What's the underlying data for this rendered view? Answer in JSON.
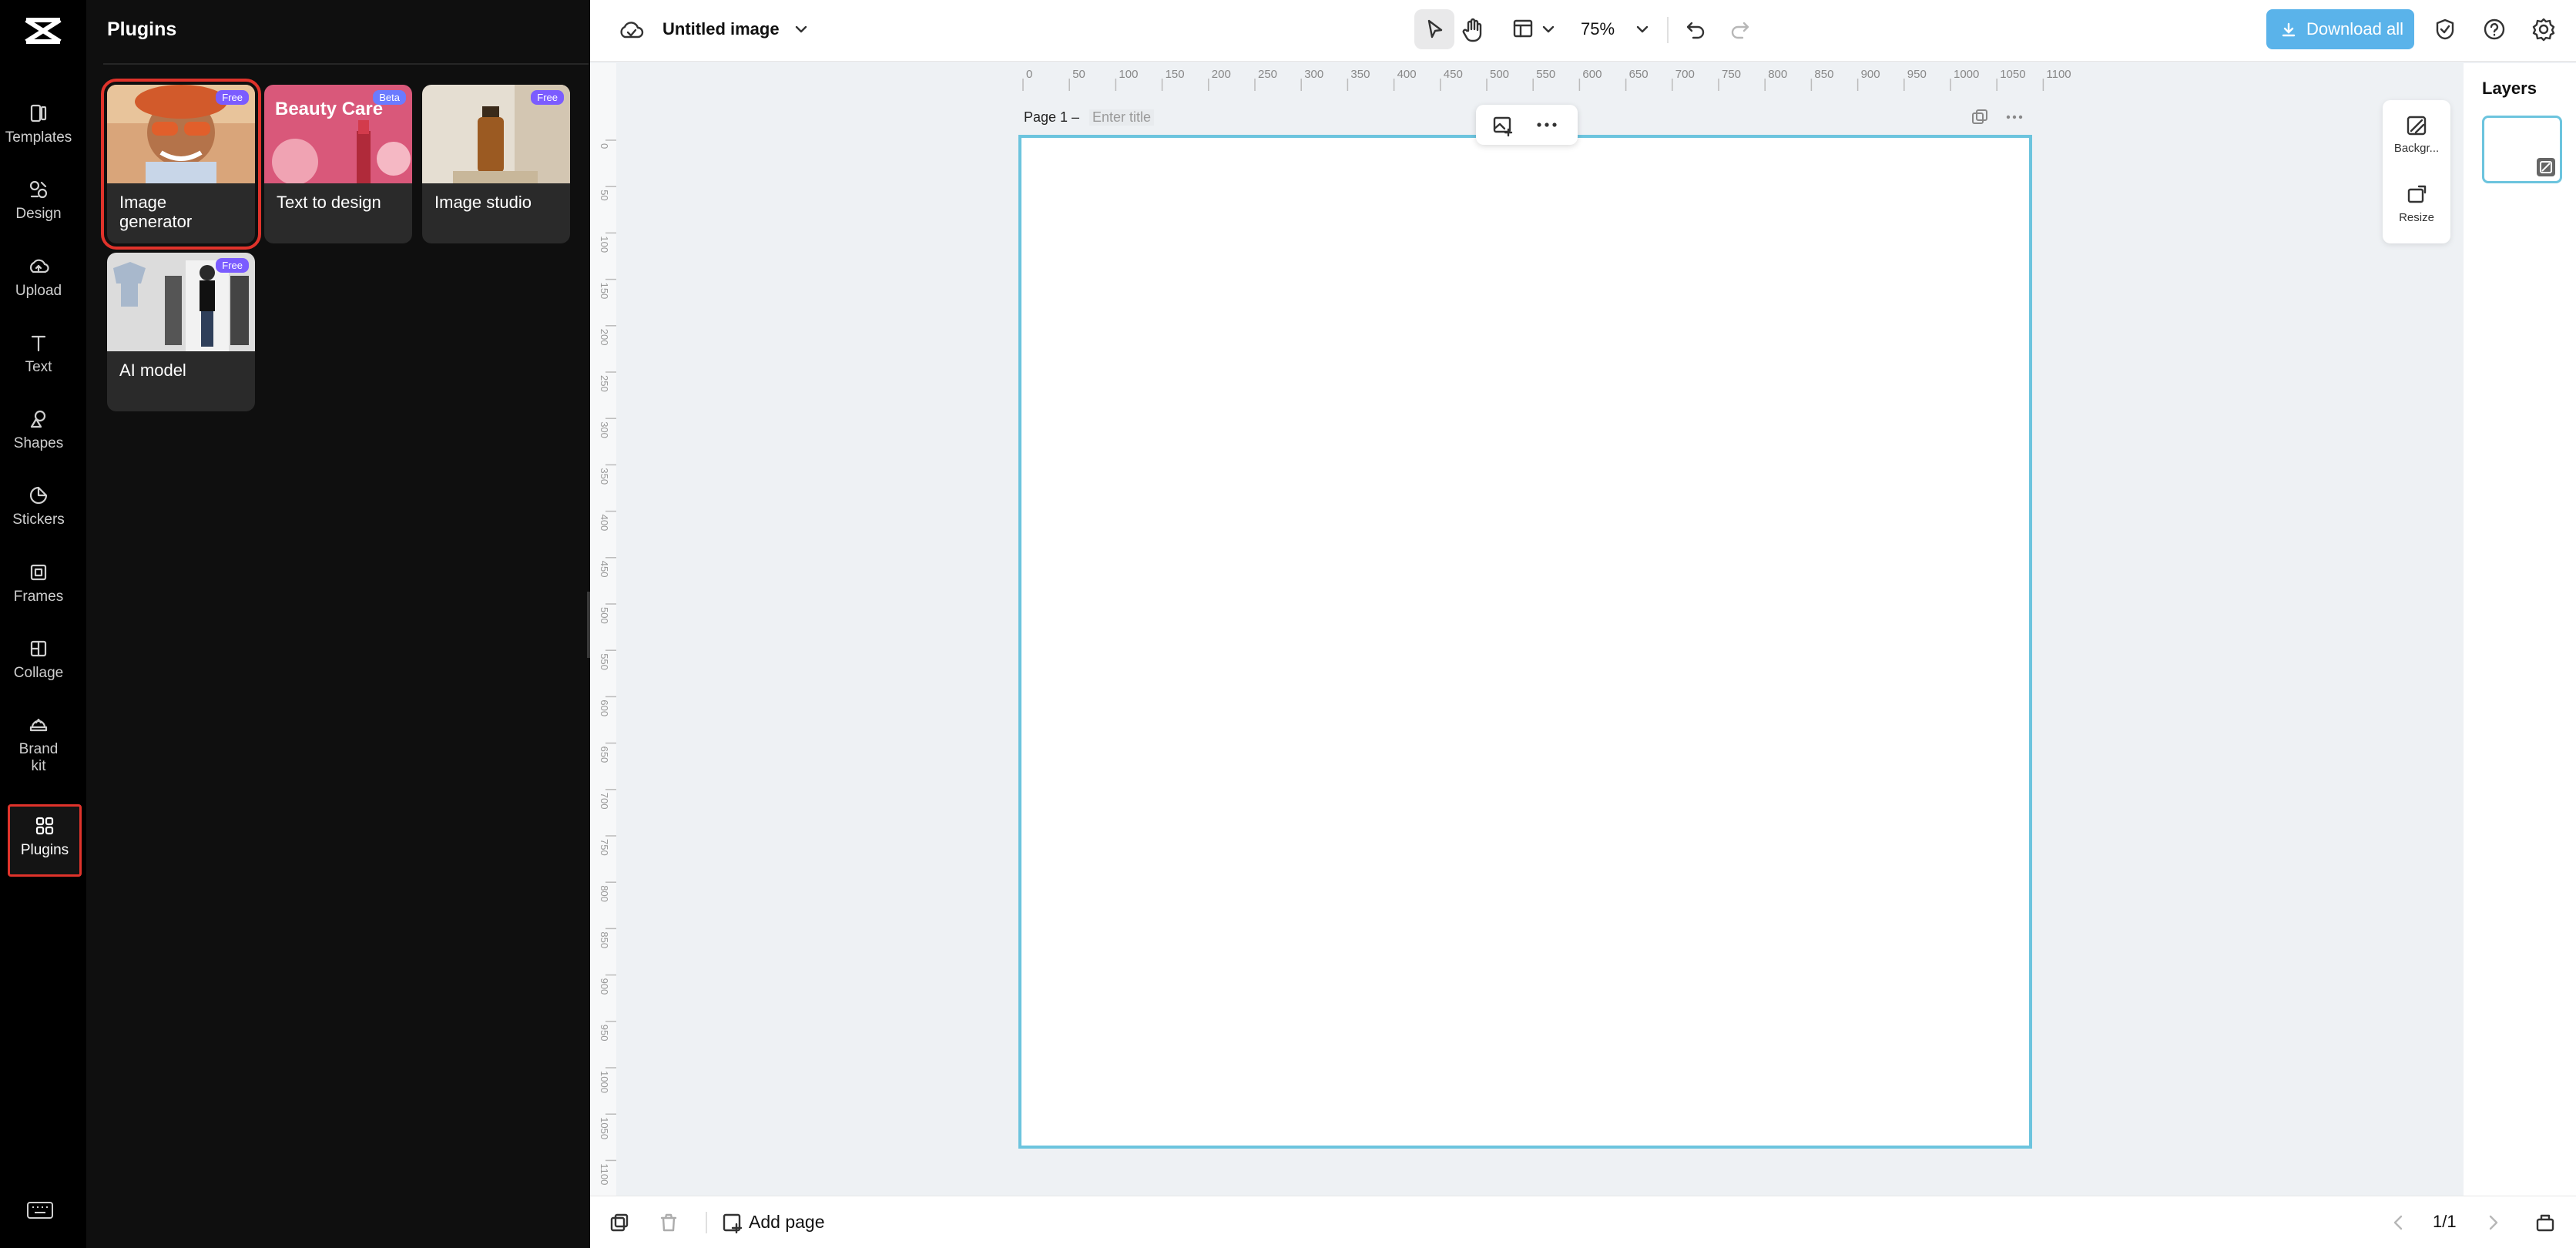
{
  "app": {
    "title": "Untitled image"
  },
  "sidebar": {
    "items": [
      {
        "label": "Templates",
        "icon": "templates-icon"
      },
      {
        "label": "Design",
        "icon": "design-icon"
      },
      {
        "label": "Upload",
        "icon": "upload-icon"
      },
      {
        "label": "Text",
        "icon": "text-icon"
      },
      {
        "label": "Shapes",
        "icon": "shapes-icon"
      },
      {
        "label": "Stickers",
        "icon": "stickers-icon"
      },
      {
        "label": "Frames",
        "icon": "frames-icon"
      },
      {
        "label": "Collage",
        "icon": "collage-icon"
      },
      {
        "label": "Brand kit",
        "icon": "brand-kit-icon"
      },
      {
        "label": "Plugins",
        "icon": "plugins-icon",
        "selected": true
      }
    ]
  },
  "plugins_panel": {
    "title": "Plugins",
    "cards": [
      {
        "label": "Image generator",
        "badge": "Free"
      },
      {
        "label": "Text to design",
        "badge": "Beta",
        "thumb_text": "Beauty Care"
      },
      {
        "label": "Image studio",
        "badge": "Free"
      },
      {
        "label": "AI model",
        "badge": "Free"
      }
    ]
  },
  "toolbar": {
    "zoom": "75%",
    "download_label": "Download all"
  },
  "canvas": {
    "page_label": "Page 1 –",
    "title_placeholder": "Enter title",
    "ruler_ticks": [
      "0",
      "50",
      "100",
      "150",
      "200",
      "250",
      "300",
      "350",
      "400",
      "450",
      "500",
      "550",
      "600",
      "650",
      "700",
      "750",
      "800",
      "850",
      "900",
      "950",
      "1000",
      "1050",
      "1100"
    ]
  },
  "side_tools": {
    "background_label": "Backgr...",
    "resize_label": "Resize"
  },
  "layers": {
    "title": "Layers"
  },
  "bottom": {
    "add_page_label": "Add page",
    "page_count": "1/1"
  },
  "colors": {
    "accent": "#5ab3ea",
    "page_border": "#6cc4de",
    "highlight": "#e0332b",
    "badge": "#7b5cff"
  }
}
